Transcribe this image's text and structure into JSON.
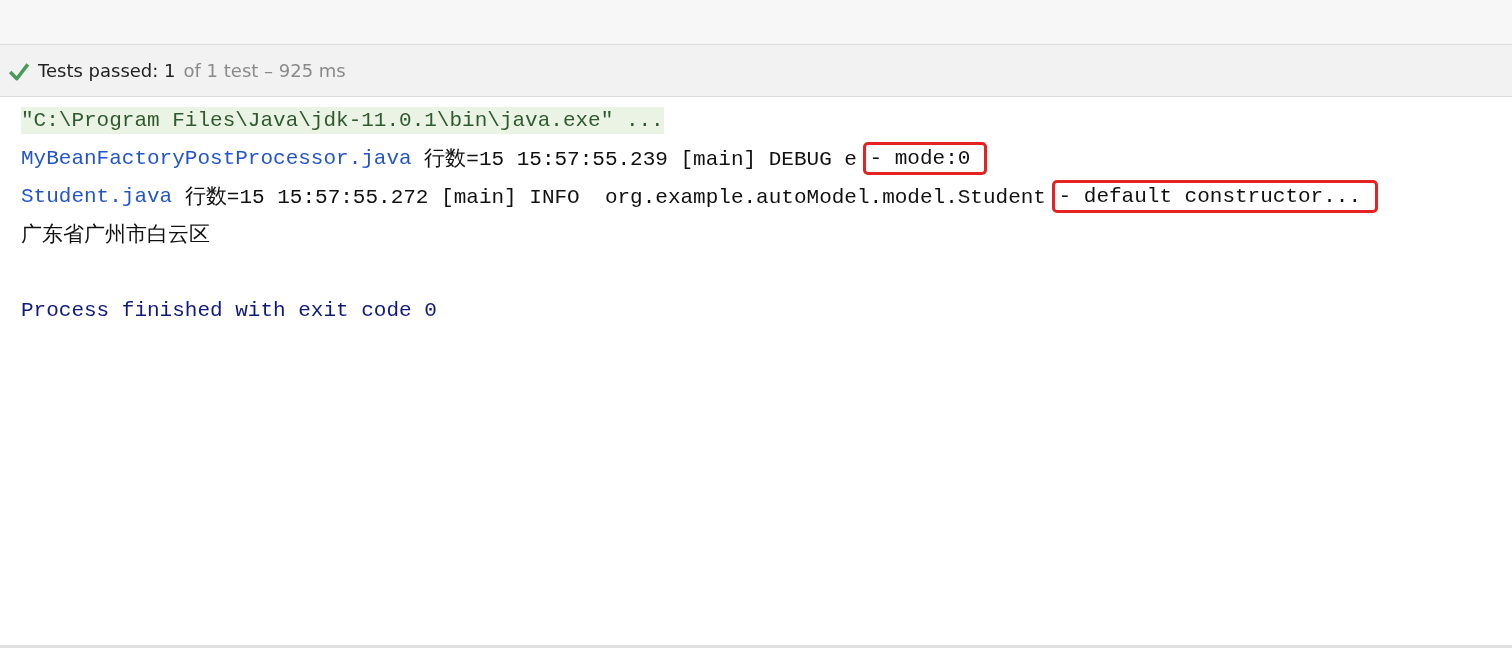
{
  "status": {
    "passed": true,
    "label": "Tests passed: 1",
    "detail": "of 1 test – 925 ms"
  },
  "console": [
    {
      "segments": [
        {
          "kind": "command",
          "text": "\"C:\\Program Files\\Java\\jdk-11.0.1\\bin\\java.exe\" ...",
          "highlighted": false
        }
      ]
    },
    {
      "segments": [
        {
          "kind": "link",
          "text": "MyBeanFactoryPostProcessor.java",
          "highlighted": false
        },
        {
          "kind": "plain",
          "text": " 行数=15 15:57:55.239 [main] DEBUG e ",
          "highlighted": false
        },
        {
          "kind": "plain",
          "text": "- mode:0",
          "highlighted": true
        }
      ]
    },
    {
      "segments": [
        {
          "kind": "link",
          "text": "Student.java",
          "highlighted": false
        },
        {
          "kind": "plain",
          "text": " 行数=15 15:57:55.272 [main] INFO  org.example.autoModel.model.Student ",
          "highlighted": false
        },
        {
          "kind": "plain",
          "text": "- default constructor...",
          "highlighted": true
        }
      ]
    },
    {
      "segments": [
        {
          "kind": "plain",
          "text": "广东省广州市白云区",
          "highlighted": false
        }
      ]
    },
    {
      "kind": "blank"
    },
    {
      "segments": [
        {
          "kind": "finished",
          "text": "Process finished with exit code 0",
          "highlighted": false
        }
      ]
    }
  ]
}
